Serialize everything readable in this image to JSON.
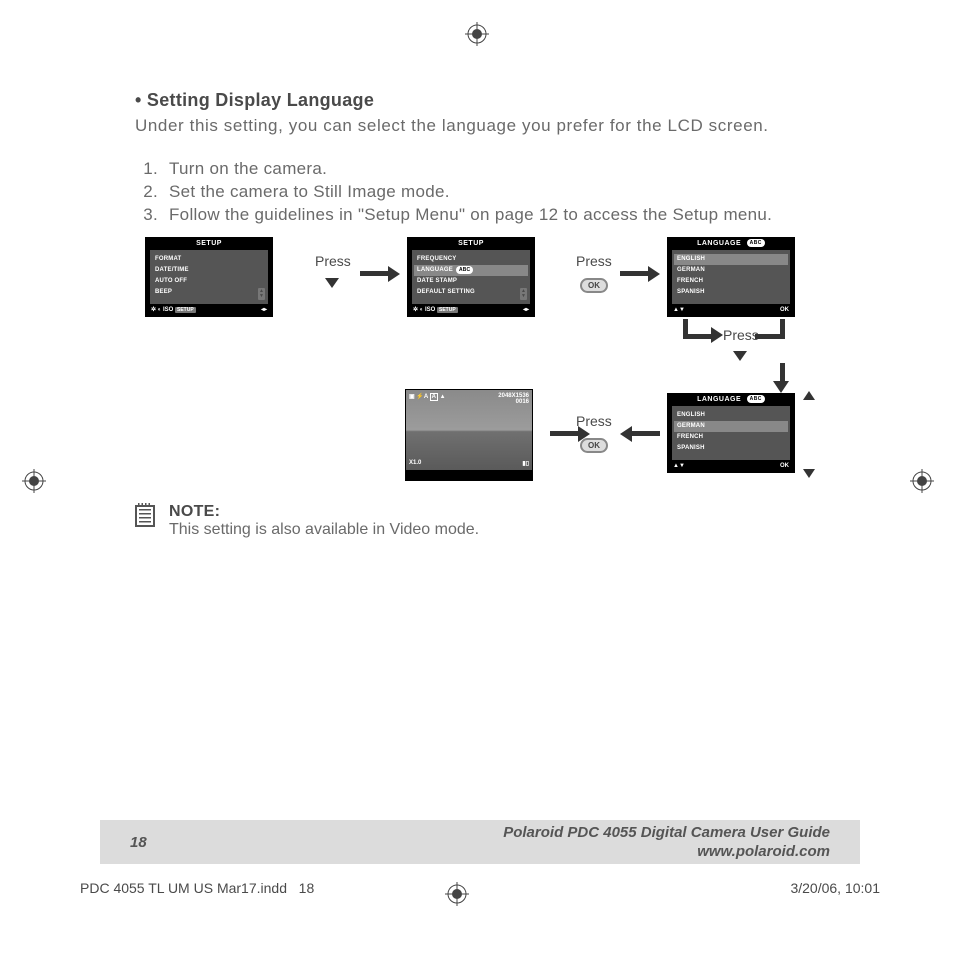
{
  "section": {
    "title": "• Setting Display Language",
    "intro": "Under this setting, you can select the language you prefer for the LCD screen."
  },
  "steps": [
    "Turn on the camera.",
    "Set the camera to Still Image mode.",
    "Follow the guidelines in \"Setup Menu\" on page 12 to access the Setup menu."
  ],
  "labels": {
    "press": "Press",
    "ok": "OK"
  },
  "screens": {
    "setup1": {
      "title": "SETUP",
      "items": [
        "FORMAT",
        "DATE/TIME",
        "AUTO OFF",
        "BEEP"
      ],
      "bot_left_iso": "ISO",
      "bot_setup": "SETUP"
    },
    "setup2": {
      "title": "SETUP",
      "items": [
        "FREQUENCY",
        "LANGUAGE",
        "DATE STAMP",
        "DEFAULT SETTING"
      ],
      "selected_index": 1,
      "abc": "ABC",
      "bot_left_iso": "ISO",
      "bot_setup": "SETUP"
    },
    "lang1": {
      "title": "LANGUAGE",
      "abc": "ABC",
      "items": [
        "ENGLISH",
        "GERMAN",
        "FRENCH",
        "SPANISH"
      ],
      "selected_index": 0,
      "bot_ok": "OK"
    },
    "lang2": {
      "title": "LANGUAGE",
      "abc": "ABC",
      "items": [
        "ENGLISH",
        "GERMAN",
        "FRENCH",
        "SPANISH"
      ],
      "selected_index": 1,
      "bot_ok": "OK"
    },
    "live": {
      "res": "2048X1536",
      "count": "0016",
      "zoom": "X1.0",
      "flash": "⚡A",
      "awb": "A"
    }
  },
  "note": {
    "label": "NOTE:",
    "text": "This setting is also available in Video mode."
  },
  "footer": {
    "page": "18",
    "title": "Polaroid PDC 4055 Digital Camera User Guide",
    "url": "www.polaroid.com",
    "file": "PDC 4055 TL UM US Mar17.indd",
    "file_page": "18",
    "date": "3/20/06, 10:01"
  }
}
